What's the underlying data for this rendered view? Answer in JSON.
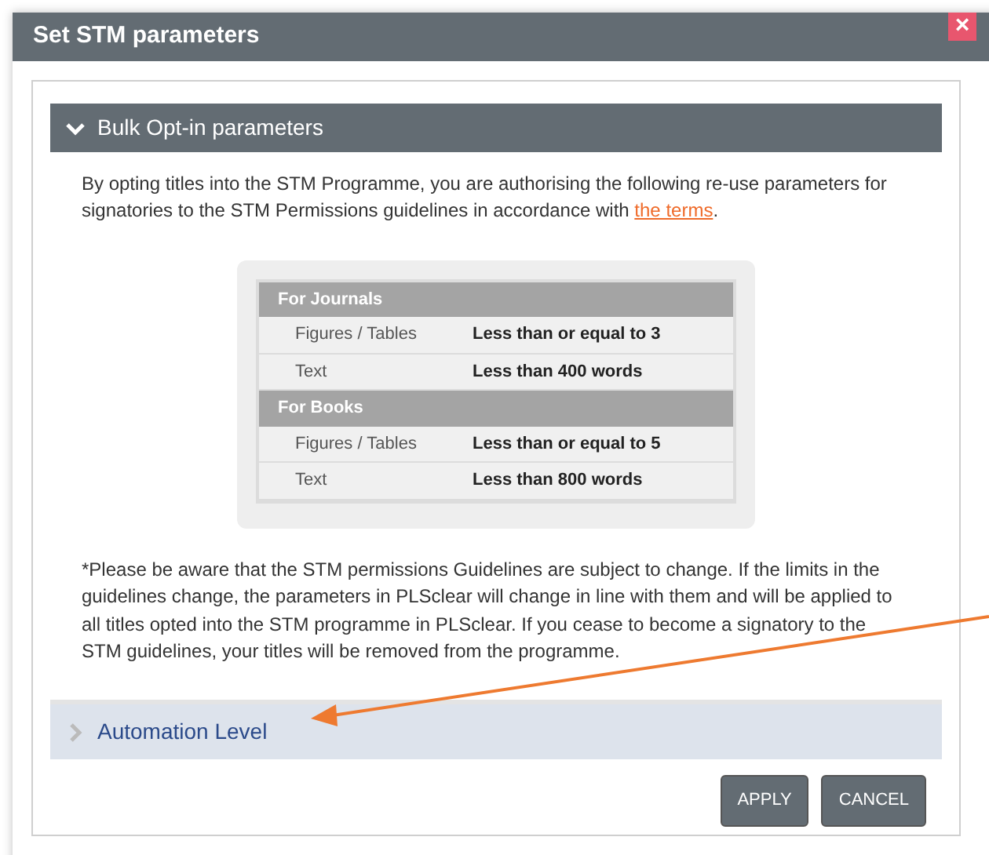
{
  "window": {
    "title": "Set STM parameters",
    "close": "×"
  },
  "sections": [
    {
      "title": "Bulk Opt-in parameters",
      "expanded": true,
      "intro": {
        "text": "By opting titles into the STM Programme, you are authorising the following re-use parameters for signatories to the STM Permissions guidelines in accordance with ",
        "link": "the terms",
        "after": "."
      },
      "table": [
        {
          "heading": "For Journals",
          "rows": [
            {
              "label": "Figures / Tables",
              "value": "Less than or equal to 3"
            },
            {
              "label": "Text",
              "value": "Less than 400 words"
            }
          ]
        },
        {
          "heading": "For Books",
          "rows": [
            {
              "label": "Figures / Tables",
              "value": "Less than or equal to 5"
            },
            {
              "label": "Text",
              "value": "Less than 800 words"
            }
          ]
        }
      ],
      "note": "*Please be aware that the STM permissions Guidelines are subject to change. If the limits in the guidelines change, the parameters in PLSclear will change in line with them and will be applied to all titles opted into the STM programme in PLSclear. If you cease to become a signatory to the STM guidelines, your titles will be removed from the programme."
    },
    {
      "title": "Automation Level",
      "expanded": false
    }
  ],
  "buttons": [
    "APPLY",
    "CANCEL"
  ]
}
